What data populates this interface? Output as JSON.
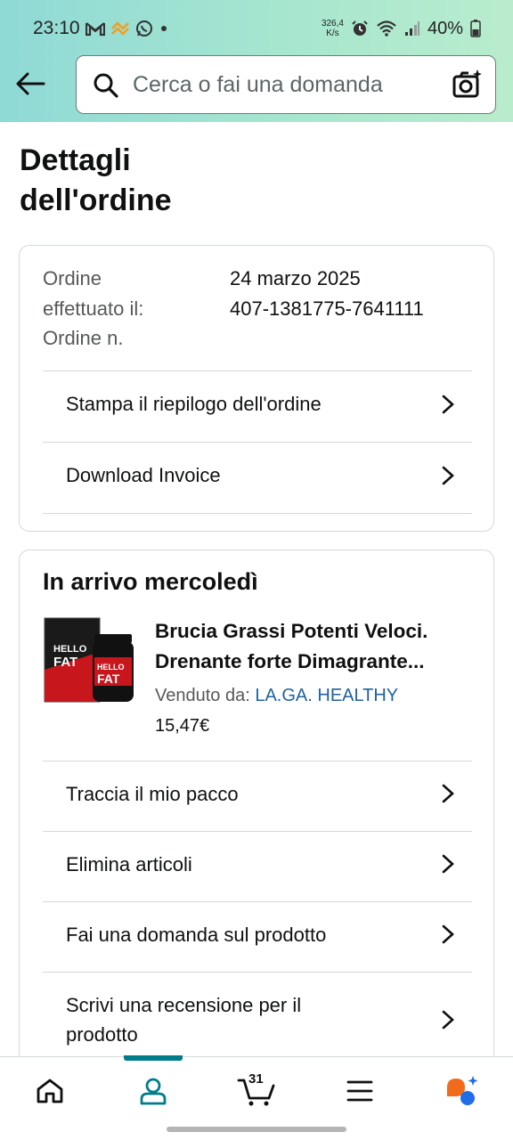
{
  "status_bar": {
    "time": "23:10",
    "net_speed_value": "326,4",
    "net_speed_unit": "K/s",
    "battery": "40%"
  },
  "header": {
    "search_placeholder": "Cerca o fai una domanda"
  },
  "page": {
    "title_line1": "Dettagli",
    "title_line2": "dell'ordine"
  },
  "order_info": {
    "label_line1": "Ordine",
    "label_line2": "effettuato il:",
    "label_line3": "Ordine n.",
    "date": "24 marzo 2025",
    "number": "407-1381775-7641111"
  },
  "order_actions": [
    {
      "label": "Stampa il riepilogo dell'ordine"
    },
    {
      "label": "Download Invoice"
    }
  ],
  "shipment": {
    "title": "In arrivo mercoledì",
    "product_title_line1": "Brucia Grassi Potenti Veloci.",
    "product_title_line2": "Drenante forte Dimagrante...",
    "seller_prefix": "Venduto da:",
    "seller_name": "LA.GA. HEALTHY",
    "price": "15,47€",
    "product_image_label_1": "HELLO",
    "product_image_label_2": "FAT"
  },
  "shipment_actions": [
    {
      "label": "Traccia il mio pacco"
    },
    {
      "label": "Elimina articoli"
    },
    {
      "label": "Fai una domanda sul prodotto"
    },
    {
      "label_line1": "Scrivi una recensione per il",
      "label_line2": "prodotto"
    }
  ],
  "bottom_nav": {
    "cart_count": "31",
    "active_tab": "account"
  },
  "colors": {
    "header_gradient_start": "#8fd9d6",
    "header_gradient_end": "#b9eccd",
    "link": "#2162a1",
    "active_indicator": "#007c89"
  }
}
